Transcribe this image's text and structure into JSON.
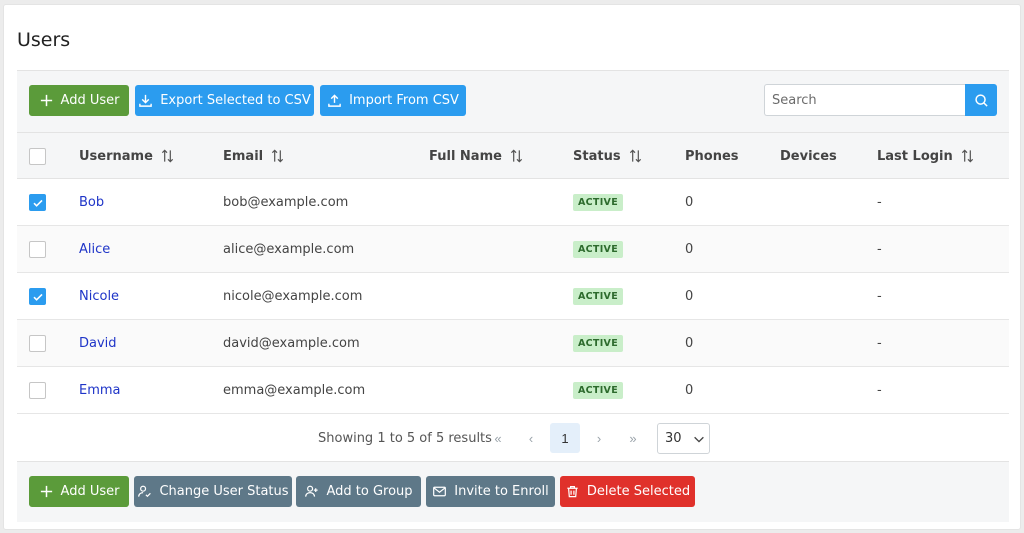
{
  "page": {
    "title": "Users"
  },
  "toolbar": {
    "add_user_label": "Add User",
    "export_label": "Export Selected to CSV",
    "import_label": "Import From CSV",
    "search_placeholder": "Search"
  },
  "table": {
    "columns": {
      "username": "Username",
      "email": "Email",
      "full_name": "Full Name",
      "status": "Status",
      "phones": "Phones",
      "devices": "Devices",
      "last_login": "Last Login"
    },
    "rows": [
      {
        "checked": true,
        "username": "Bob",
        "email": "bob@example.com",
        "full_name": "",
        "status": "ACTIVE",
        "phones": "0",
        "devices": "",
        "last_login": "-"
      },
      {
        "checked": false,
        "username": "Alice",
        "email": "alice@example.com",
        "full_name": "",
        "status": "ACTIVE",
        "phones": "0",
        "devices": "",
        "last_login": "-"
      },
      {
        "checked": true,
        "username": "Nicole",
        "email": "nicole@example.com",
        "full_name": "",
        "status": "ACTIVE",
        "phones": "0",
        "devices": "",
        "last_login": "-"
      },
      {
        "checked": false,
        "username": "David",
        "email": "david@example.com",
        "full_name": "",
        "status": "ACTIVE",
        "phones": "0",
        "devices": "",
        "last_login": "-"
      },
      {
        "checked": false,
        "username": "Emma",
        "email": "emma@example.com",
        "full_name": "",
        "status": "ACTIVE",
        "phones": "0",
        "devices": "",
        "last_login": "-"
      }
    ]
  },
  "pagination": {
    "summary": "Showing 1 to 5 of 5 results",
    "first": "«",
    "prev": "‹",
    "current_page": "1",
    "next": "›",
    "last": "»",
    "page_size": "30"
  },
  "footer": {
    "add_user_label": "Add User",
    "change_status_label": "Change User Status",
    "add_group_label": "Add to Group",
    "invite_label": "Invite to Enroll",
    "delete_label": "Delete Selected"
  },
  "colors": {
    "green": "#5b9b3a",
    "blue": "#2b9cef",
    "gray": "#5e7888",
    "red": "#e0312b",
    "link": "#1f35c8",
    "badge_bg": "#c9eec9"
  },
  "icons": {
    "add": "plus-icon",
    "export": "download-icon",
    "import": "upload-icon",
    "search": "search-icon",
    "sort": "sort-icon",
    "status": "user-check-icon",
    "group": "user-plus-icon",
    "invite": "envelope-icon",
    "delete": "trash-icon"
  }
}
